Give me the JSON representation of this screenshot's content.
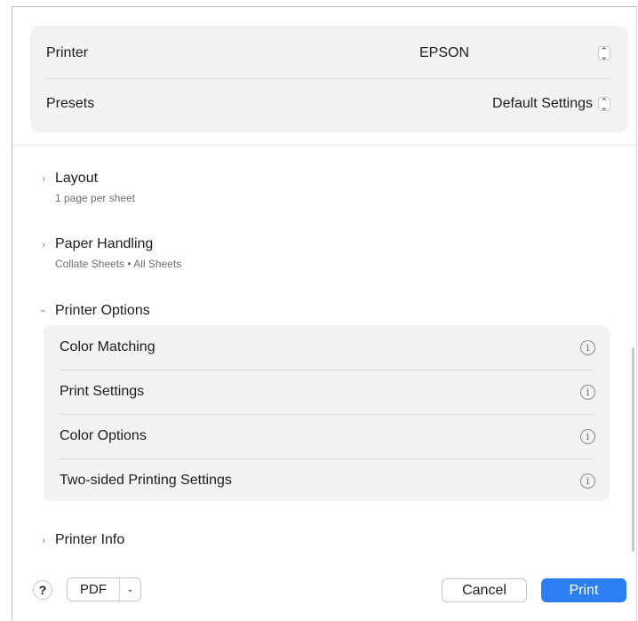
{
  "top": {
    "printer": {
      "label": "Printer",
      "value": "EPSON"
    },
    "presets": {
      "label": "Presets",
      "value": "Default Settings"
    }
  },
  "sections": {
    "layout": {
      "title": "Layout",
      "subtitle": "1 page per sheet"
    },
    "paper_handling": {
      "title": "Paper Handling",
      "subtitle": "Collate Sheets • All Sheets"
    },
    "printer_options": {
      "title": "Printer Options"
    },
    "printer_info": {
      "title": "Printer Info"
    }
  },
  "printer_options": [
    {
      "label": "Color Matching"
    },
    {
      "label": "Print Settings"
    },
    {
      "label": "Color Options"
    },
    {
      "label": "Two-sided Printing Settings"
    }
  ],
  "icons": {
    "chevron_right": "›",
    "info": "i",
    "help": "?"
  },
  "bottom": {
    "help": "?",
    "pdf": "PDF",
    "cancel": "Cancel",
    "print": "Print"
  },
  "colors": {
    "accent": "#2b7ff2",
    "panel": "#f2f2f2"
  }
}
